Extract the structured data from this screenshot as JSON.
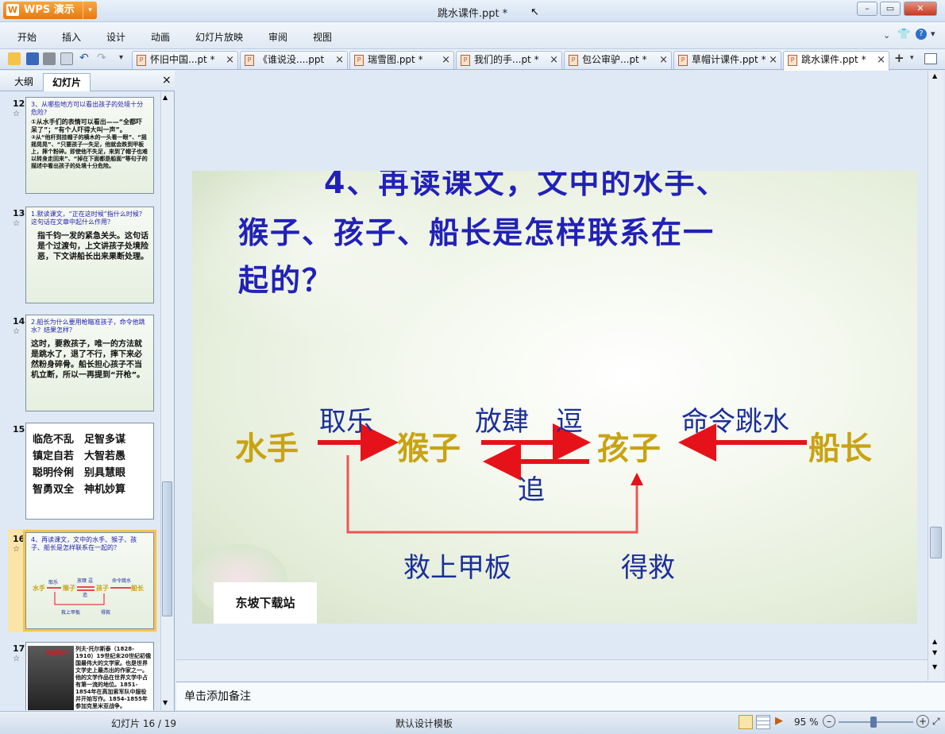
{
  "app": {
    "wps_button": "WPS 演示",
    "logo_glyph": "W",
    "doc_title": "跳水课件.ppt *"
  },
  "menu": [
    "开始",
    "插入",
    "设计",
    "动画",
    "幻灯片放映",
    "审阅",
    "视图"
  ],
  "doc_tabs": [
    "怀旧中国...pt *",
    "《谁说没....ppt",
    "瑞雪图.ppt *",
    "我们的手...pt *",
    "包公审驴...pt *",
    "草帽计课件.ppt *",
    "跳水课件.ppt *"
  ],
  "panel": {
    "tab_outline": "大纲",
    "tab_slides": "幻灯片"
  },
  "thumbs": [
    {
      "num": "12",
      "lines": [
        "3、从哪些地方可以看出孩子的处境十分危险?",
        "①从水手们的表情可以看出——“全都吓呆了”；“有个人吓得大叫一声”。",
        "②从“他杆到挂帽子的横木的一头看一眼”、“摇摇晃晃”、“只要孩子一失足，他就会跌到甲板上，摔个粉碎。即使他不失足，来到了帽子也难以转身走回来”、“掉在下面都是船面”等句子的描述中看出孩子的处境十分危险。"
      ]
    },
    {
      "num": "13",
      "lines": [
        "1.默读课文，“正在这时候”指什么时候？这句话在文章中起什么作用？",
        "指千钧一发的紧急关头。这句话是个过渡句，上文讲孩子处境险恶，下文讲船长出来果断处理。"
      ]
    },
    {
      "num": "14",
      "lines": [
        "2.船长为什么要用枪瞄准孩子，命令他跳水？结果怎样？",
        "这时，要救孩子，唯一的方法就是跳水了，退了不行，摔下来必然粉身碎骨。船长担心孩子不当机立断，所以一再提到“开枪”。"
      ]
    },
    {
      "num": "15",
      "lines": [
        "临危不乱　足智多谋",
        "镇定自若　大智若愚",
        "聪明伶俐　别具慧眼",
        "智勇双全　神机妙算"
      ]
    },
    {
      "num": "16",
      "lines": [
        "4、再读课文，文中的水手、猴子、孩子、船长是怎样联系在一起的？"
      ]
    },
    {
      "num": "17",
      "lines": [
        "列夫·托尔斯泰（1828-1910）19世纪末20世纪初俄国最伟大的文学家。也是世界文学史上最杰出的作家之一。他的文学作品在世界文学中占有第一流的地位。1851-1854年在高加索军队中服役并开始写作。1854-1855年参加克里米亚战争。"
      ],
      "portrait_label": "作者简介："
    }
  ],
  "slide": {
    "question": [
      "4、再读课文，文中的水手、",
      "猴子、孩子、船长是怎样联系在一",
      "起的？"
    ],
    "nodes": {
      "sailor": "水手",
      "monkey": "猴子",
      "child": "孩子",
      "captain": "船长"
    },
    "labels": {
      "qule": "取乐",
      "fangsi": "放肆",
      "dou": "逗",
      "zhui": "追",
      "mingling": "命令跳水",
      "jiu": "救上甲板",
      "dejiu": "得救"
    },
    "watermark": "东坡下载站"
  },
  "notes": "单击添加备注",
  "status": {
    "slide_pos": "幻灯片 16 / 19",
    "template": "默认设计模板",
    "zoom": "95 %"
  },
  "colors": {
    "accent_orange": "#e57a10",
    "question_blue": "#2121b8",
    "node_gold": "#c8a312",
    "arrow_red": "#e6121a"
  }
}
